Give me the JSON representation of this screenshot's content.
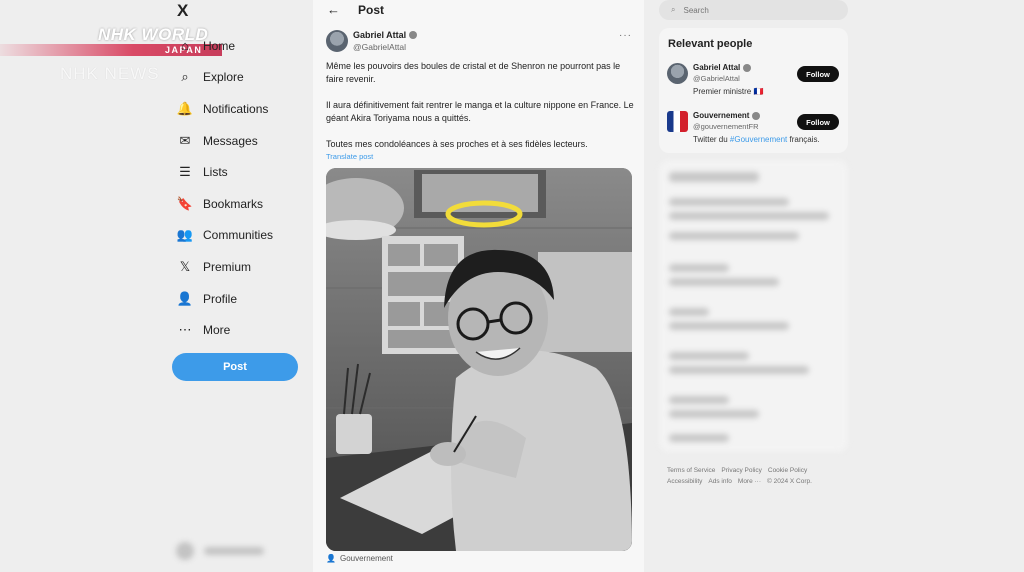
{
  "overlay": {
    "brand": "NHK WORLD",
    "region": "JAPAN",
    "channel": "NHK NEWS"
  },
  "logo": "X",
  "nav": {
    "items": [
      {
        "label": "Home",
        "icon": "home-icon",
        "glyph": "⌂"
      },
      {
        "label": "Explore",
        "icon": "search-icon",
        "glyph": "⌕"
      },
      {
        "label": "Notifications",
        "icon": "bell-icon",
        "glyph": "🔔"
      },
      {
        "label": "Messages",
        "icon": "mail-icon",
        "glyph": "✉"
      },
      {
        "label": "Lists",
        "icon": "list-icon",
        "glyph": "☰"
      },
      {
        "label": "Bookmarks",
        "icon": "bookmark-icon",
        "glyph": "🔖"
      },
      {
        "label": "Communities",
        "icon": "people-icon",
        "glyph": "👥"
      },
      {
        "label": "Premium",
        "icon": "x-premium-icon",
        "glyph": "𝕏"
      },
      {
        "label": "Profile",
        "icon": "person-icon",
        "glyph": "👤"
      },
      {
        "label": "More",
        "icon": "more-circle-icon",
        "glyph": "⋯"
      }
    ],
    "post_button": "Post"
  },
  "post": {
    "header_title": "Post",
    "author_name": "Gabriel Attal",
    "author_handle": "@GabrielAttal",
    "paragraphs": [
      "Même les pouvoirs des boules de cristal et de Shenron ne pourront pas le faire revenir.",
      "Il aura définitivement fait rentrer le manga et la culture nippone en France. Le géant Akira Toriyama nous a quittés.",
      "Toutes mes condoléances à ses proches et à ses fidèles lecteurs."
    ],
    "translate_label": "Translate post",
    "media_caption": "Gouvernement"
  },
  "search": {
    "placeholder": "Search"
  },
  "relevant": {
    "title": "Relevant people",
    "people": [
      {
        "name": "Gabriel Attal",
        "handle": "@GabrielAttal",
        "bio": "Premier ministre 🇫🇷",
        "follow": "Follow"
      },
      {
        "name": "Gouvernement",
        "handle": "@gouvernementFR",
        "bio_prefix": "Twitter du ",
        "bio_link": "#Gouvernement",
        "bio_suffix": " français.",
        "follow": "Follow"
      }
    ]
  },
  "footer": {
    "links": [
      "Terms of Service",
      "Privacy Policy",
      "Cookie Policy",
      "Accessibility",
      "Ads info",
      "More ···",
      "© 2024 X Corp."
    ]
  },
  "colors": {
    "accent": "#3d9be9",
    "follow_bg": "#111111",
    "nhk_red": "#d94a66"
  }
}
